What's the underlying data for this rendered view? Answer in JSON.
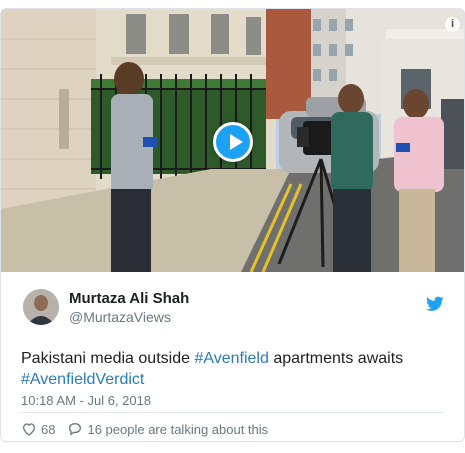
{
  "video": {
    "play_icon": "play-icon",
    "info_icon": "info-icon",
    "info_glyph": "i"
  },
  "author": {
    "name": "Murtaza Ali Shah",
    "handle": "@MurtazaViews",
    "avatar_icon": "avatar",
    "brand_icon": "twitter-bird-icon",
    "brand_color": "#1da1f2"
  },
  "tweet": {
    "text_before": "Pakistani media outside ",
    "hashtag_1": "#Avenfield",
    "text_middle": " apartments awaits ",
    "hashtag_2": "#AvenfieldVerdict",
    "hashtag_color": "#2b7bb9",
    "timestamp": "10:18 AM - Jul 6, 2018"
  },
  "actions": {
    "like_icon": "heart-icon",
    "like_count": "68",
    "reply_icon": "speech-bubble-icon",
    "talking_text": "16 people are talking about this"
  }
}
